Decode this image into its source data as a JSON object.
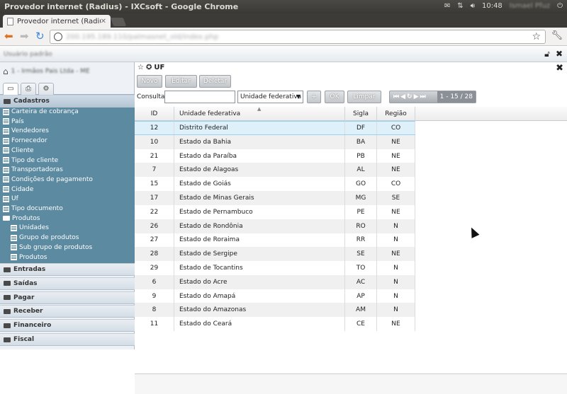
{
  "os": {
    "title": "Provedor internet (Radius) - IXCsoft - Google Chrome",
    "clock": "10:48",
    "user": "Ismael Pfuz"
  },
  "browser": {
    "tab_title": "Provedor internet (Radius...",
    "url": "200.195.189.110/palmasnet_old/index.php"
  },
  "app": {
    "user": "Usuário padrão",
    "company": "1 - Irmãos Pais Ltda - ME"
  },
  "sidebar": {
    "open_section": "Cadastros",
    "items": [
      {
        "label": "Carteira de cobrança",
        "type": "doc"
      },
      {
        "label": "País",
        "type": "doc"
      },
      {
        "label": "Vendedores",
        "type": "doc"
      },
      {
        "label": "Fornecedor",
        "type": "doc"
      },
      {
        "label": "Cliente",
        "type": "doc"
      },
      {
        "label": "Tipo de cliente",
        "type": "doc"
      },
      {
        "label": "Transportadoras",
        "type": "doc"
      },
      {
        "label": "Condições de pagamento",
        "type": "doc"
      },
      {
        "label": "Cidade",
        "type": "doc"
      },
      {
        "label": "Uf",
        "type": "doc"
      },
      {
        "label": "Tipo documento",
        "type": "doc"
      },
      {
        "label": "Produtos",
        "type": "folder"
      },
      {
        "label": "Unidades",
        "type": "doc",
        "indent": 1
      },
      {
        "label": "Grupo de produtos",
        "type": "doc",
        "indent": 1
      },
      {
        "label": "Sub grupo de produtos",
        "type": "doc",
        "indent": 1
      },
      {
        "label": "Produtos",
        "type": "doc",
        "indent": 1
      }
    ],
    "sections": [
      "Entradas",
      "Saídas",
      "Pagar",
      "Receber",
      "Financeiro",
      "Fiscal"
    ]
  },
  "panel": {
    "title": "UF",
    "buttons": {
      "novo": "Novo",
      "editar": "Editar",
      "deletar": "Deletar"
    },
    "consultar_label": "Consultar",
    "search_value": "",
    "search_field": "Unidade federativa",
    "plus": "+",
    "ok": "OK",
    "limpar": "Limpar",
    "pager_count": "1 - 15 / 28"
  },
  "table": {
    "headers": {
      "id": "ID",
      "name": "Unidade federativa",
      "sigla": "Sigla",
      "regiao": "Região"
    },
    "rows": [
      {
        "id": "12",
        "name": "Distrito Federal",
        "sigla": "DF",
        "regiao": "CO"
      },
      {
        "id": "10",
        "name": "Estado da Bahia",
        "sigla": "BA",
        "regiao": "NE"
      },
      {
        "id": "21",
        "name": "Estado da Paraíba",
        "sigla": "PB",
        "regiao": "NE"
      },
      {
        "id": "7",
        "name": "Estado de Alagoas",
        "sigla": "AL",
        "regiao": "NE"
      },
      {
        "id": "15",
        "name": "Estado de Goiás",
        "sigla": "GO",
        "regiao": "CO"
      },
      {
        "id": "17",
        "name": "Estado de Minas Gerais",
        "sigla": "MG",
        "regiao": "SE"
      },
      {
        "id": "22",
        "name": "Estado de Pernambuco",
        "sigla": "PE",
        "regiao": "NE"
      },
      {
        "id": "26",
        "name": "Estado de Rondônia",
        "sigla": "RO",
        "regiao": "N"
      },
      {
        "id": "27",
        "name": "Estado de Roraima",
        "sigla": "RR",
        "regiao": "N"
      },
      {
        "id": "28",
        "name": "Estado de Sergipe",
        "sigla": "SE",
        "regiao": "NE"
      },
      {
        "id": "29",
        "name": "Estado de Tocantins",
        "sigla": "TO",
        "regiao": "N"
      },
      {
        "id": "6",
        "name": "Estado do Acre",
        "sigla": "AC",
        "regiao": "N"
      },
      {
        "id": "9",
        "name": "Estado do Amapá",
        "sigla": "AP",
        "regiao": "N"
      },
      {
        "id": "8",
        "name": "Estado do Amazonas",
        "sigla": "AM",
        "regiao": "N"
      },
      {
        "id": "11",
        "name": "Estado do Ceará",
        "sigla": "CE",
        "regiao": "NE"
      }
    ]
  }
}
